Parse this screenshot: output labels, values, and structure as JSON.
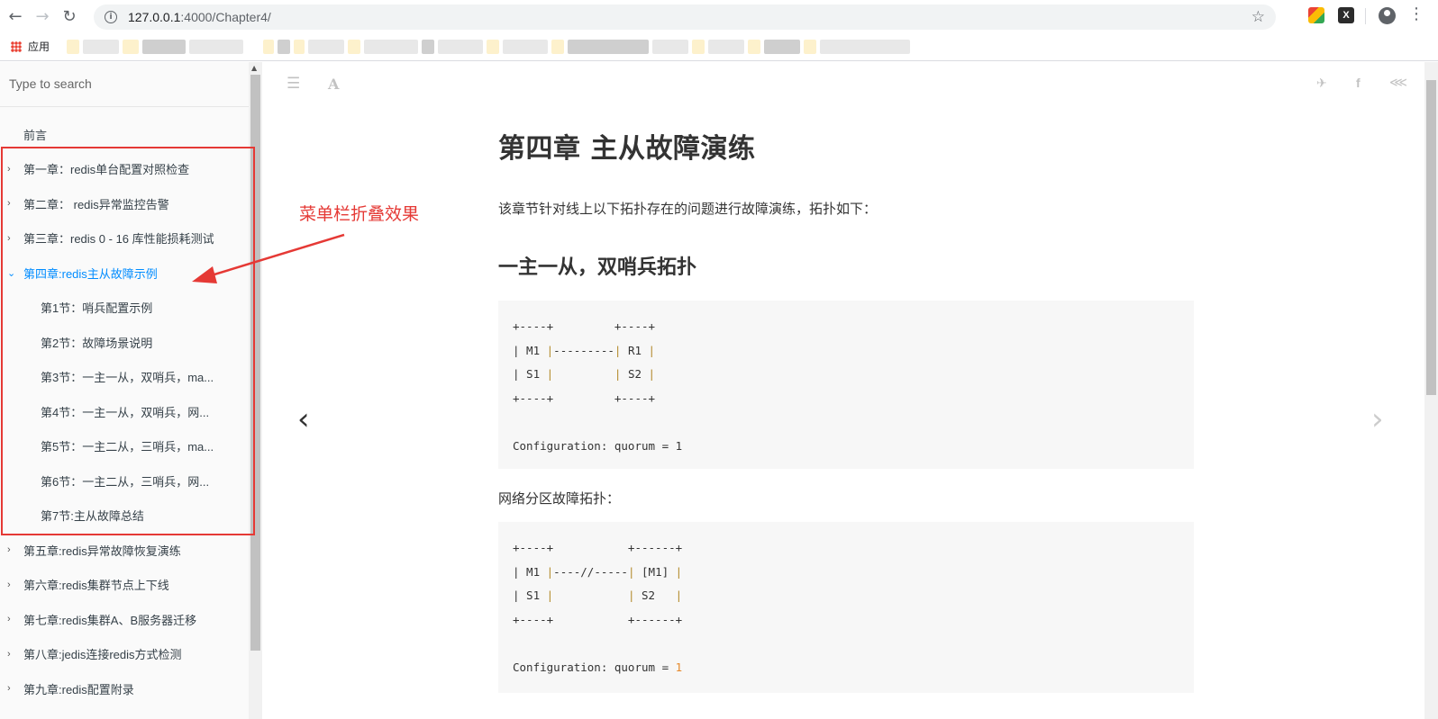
{
  "browser": {
    "back_icon": "arrow-left-icon",
    "forward_icon": "arrow-right-icon",
    "reload_icon": "reload-icon",
    "url_host": "127.0.0.1",
    "url_rest": ":4000/Chapter4/",
    "bookmark_apps_label": "应用"
  },
  "sidebar": {
    "search_placeholder": "Type to search",
    "items": [
      {
        "label": "前言"
      },
      {
        "label": "第一章：redis单台配置对照检查"
      },
      {
        "label": "第二章： redis异常监控告警"
      },
      {
        "label": "第三章：redis 0 - 16 库性能损耗测试"
      },
      {
        "label": "第四章:redis主从故障示例"
      },
      {
        "label": "第1节：哨兵配置示例"
      },
      {
        "label": "第2节：故障场景说明"
      },
      {
        "label": "第3节：一主一从，双哨兵，ma..."
      },
      {
        "label": "第4节：一主一从，双哨兵，网..."
      },
      {
        "label": "第5节：一主二从，三哨兵，ma..."
      },
      {
        "label": "第6节：一主二从，三哨兵，网..."
      },
      {
        "label": "第7节:主从故障总结"
      },
      {
        "label": "第五章:redis异常故障恢复演练"
      },
      {
        "label": "第六章:redis集群节点上下线"
      },
      {
        "label": "第七章:redis集群A、B服务器迁移"
      },
      {
        "label": "第八章:jedis连接redis方式检测"
      },
      {
        "label": "第九章:redis配置附录"
      }
    ]
  },
  "annotation": {
    "text": "菜单栏折叠效果"
  },
  "content": {
    "title": "第四章 主从故障演练",
    "intro": "该章节针对线上以下拓扑存在的问题进行故障演练，拓扑如下：",
    "section1_title": "一主一从，双哨兵拓扑",
    "code1": {
      "l1a": "+----+",
      "l1b": "         +----+",
      "l2a": "| M1 ",
      "l2b": "|",
      "l2c": "---------",
      "l2d": "|",
      "l2e": " R1 ",
      "l2f": "|",
      "l3a": "| S1 ",
      "l3b": "|",
      "l3c": "         ",
      "l3d": "|",
      "l3e": " S2 ",
      "l3f": "|",
      "l4": "+----+         +----+",
      "config": "Configuration: quorum = 1"
    },
    "section2_text": "网络分区故障拓扑：",
    "code2": {
      "l1": "+----+           +------+",
      "l2a": "| M1 ",
      "l2b": "|",
      "l2c": "----//-----",
      "l2d": "|",
      "l2e": " [M1] ",
      "l2f": "|",
      "l3a": "| S1 ",
      "l3b": "|",
      "l3c": "           ",
      "l3d": "|",
      "l3e": " S2   ",
      "l3f": "|",
      "l4": "+----+           +------+",
      "config_prefix": "Configuration: quorum = ",
      "config_value": "1"
    }
  }
}
